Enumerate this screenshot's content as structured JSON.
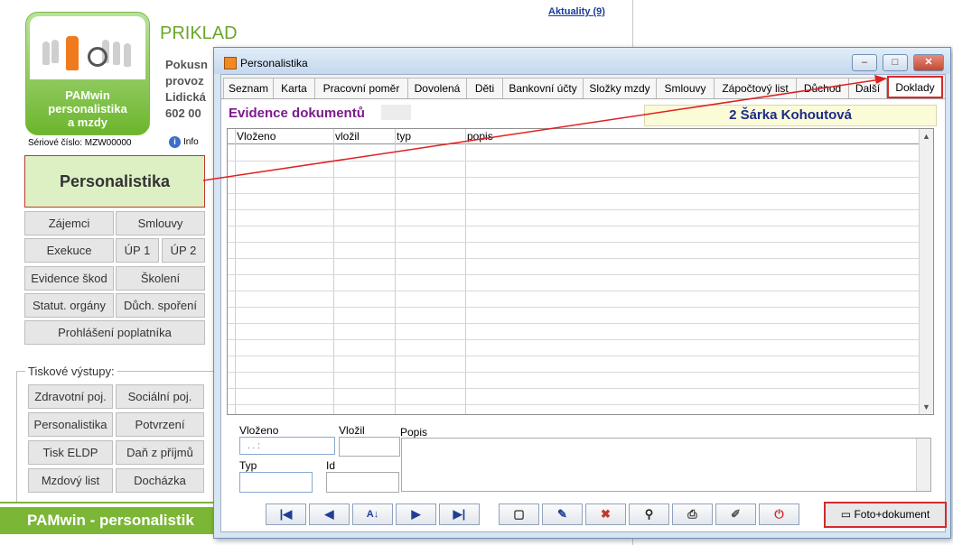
{
  "bg": {
    "news_link": "Aktuality (9)",
    "app_title": "PRIKLAD",
    "company_lines": [
      "Pokusn",
      "provoz",
      "Lidická",
      "602 00"
    ],
    "logo_text": [
      "PAMwin",
      "personalistika",
      "a mzdy"
    ],
    "serial": "Sériové číslo: MZW00000",
    "info_label": "Info",
    "main_button": "Personalistika",
    "buttons": {
      "zajemci": "Zájemci",
      "smlouvy": "Smlouvy",
      "exekuce": "Exekuce",
      "up1": "ÚP 1",
      "up2": "ÚP 2",
      "evidence_skod": "Evidence škod",
      "skoleni": "Školení",
      "statut_organy": "Statut. orgány",
      "duch_sporeni": "Důch. spoření",
      "prohlaseni": "Prohlášení poplatníka"
    },
    "print_group_label": "Tiskové výstupy:",
    "print_buttons": {
      "zdravotni": "Zdravotní poj.",
      "socialni": "Sociální poj.",
      "personalistika": "Personalistika",
      "potvrzeni": "Potvrzení",
      "eldp": "Tisk ELDP",
      "dan": "Daň z příjmů",
      "mzdovy_list": "Mzdový list",
      "dochazka": "Docházka"
    },
    "footer": "PAMwin - personalistik"
  },
  "dialog": {
    "title": "Personalistika",
    "window_buttons": {
      "minimize": "–",
      "maximize": "□",
      "close": "✕"
    },
    "tabs": [
      "Seznam",
      "Karta",
      "Pracovní poměr",
      "Dovolená",
      "Děti",
      "Bankovní účty",
      "Složky mzdy",
      "Smlouvy",
      "Zápočtový list",
      "Důchod",
      "Další",
      "Doklady"
    ],
    "active_tab": "Doklady",
    "heading": "Evidence dokumentů",
    "person": "2 Šárka Kohoutová",
    "grid_columns": [
      "Vloženo",
      "vložil",
      "typ",
      "popis"
    ],
    "form": {
      "vlozeno_label": "Vloženo",
      "vlozeno_value": ". .    :",
      "vlozil_label": "Vložil",
      "popis_label": "Popis",
      "typ_label": "Typ",
      "id_label": "Id"
    },
    "photo_button": "Foto+dokument",
    "icons": {
      "first": "first-record-icon",
      "prev": "prev-record-icon",
      "sort": "sort-az-icon",
      "next": "next-record-icon",
      "last": "last-record-icon",
      "new": "new-document-icon",
      "edit": "edit-icon",
      "delete": "delete-icon",
      "find": "find-icon",
      "print": "print-icon",
      "scan": "scanner-icon",
      "exit": "power-icon"
    },
    "accent_color": "#d12b2b"
  }
}
